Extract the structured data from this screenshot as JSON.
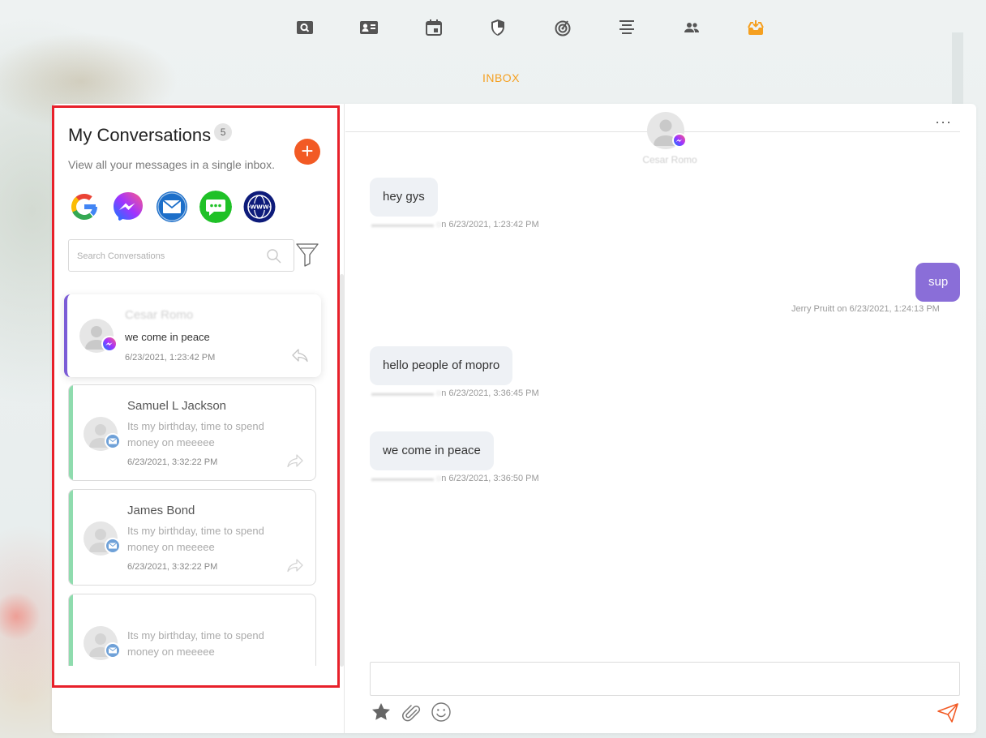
{
  "nav": {
    "items": [
      {
        "icon": "search-box-icon",
        "active": false
      },
      {
        "icon": "contact-card-icon",
        "active": false
      },
      {
        "icon": "calendar-icon",
        "active": false
      },
      {
        "icon": "shield-icon",
        "active": false
      },
      {
        "icon": "target-icon",
        "active": false
      },
      {
        "icon": "align-center-icon",
        "active": false
      },
      {
        "icon": "people-icon",
        "active": false
      },
      {
        "icon": "inbox-icon",
        "active": true
      }
    ],
    "active_label": "INBOX",
    "active_color": "#f5a020"
  },
  "conversations_panel": {
    "title": "My Conversations",
    "count": "5",
    "subtitle": "View all your messages in a single inbox.",
    "add_label": "+",
    "channels": [
      "google-icon",
      "messenger-icon",
      "email-icon",
      "sms-icon",
      "web-icon"
    ],
    "search_placeholder": "Search Conversations",
    "items": [
      {
        "name": "Cesar Romo",
        "message": "we come in peace",
        "time": "6/23/2021, 1:23:42 PM",
        "source": "messenger",
        "active": true
      },
      {
        "name": "Samuel L Jackson",
        "message": "Its my birthday, time to spend money on meeeee",
        "time": "6/23/2021, 3:32:22 PM",
        "source": "email",
        "active": false
      },
      {
        "name": "James Bond",
        "message": "Its my birthday, time to spend money on meeeee",
        "time": "6/23/2021, 3:32:22 PM",
        "source": "email",
        "active": false
      },
      {
        "name": "",
        "message": "Its my birthday, time to spend money on meeeee",
        "time": "",
        "source": "email",
        "active": false
      }
    ]
  },
  "chat": {
    "contact_name": "Cesar Romo",
    "more_label": "···",
    "messages": [
      {
        "direction": "in",
        "text": "hey gys",
        "meta": "6/23/2021, 1:23:42 PM"
      },
      {
        "direction": "out",
        "text": "sup",
        "meta": "Jerry Pruitt on 6/23/2021, 1:24:13 PM"
      },
      {
        "direction": "in",
        "text": "hello people of mopro",
        "meta": "6/23/2021, 3:36:45 PM"
      },
      {
        "direction": "in",
        "text": "we come in peace",
        "meta": "6/23/2021, 3:36:50 PM"
      }
    ],
    "input_value": "",
    "tools": [
      "star-icon",
      "paperclip-icon",
      "emoji-icon"
    ],
    "send_icon": "send-icon",
    "accent_color": "#f25a24",
    "outgoing_color": "#8a6ed8"
  }
}
